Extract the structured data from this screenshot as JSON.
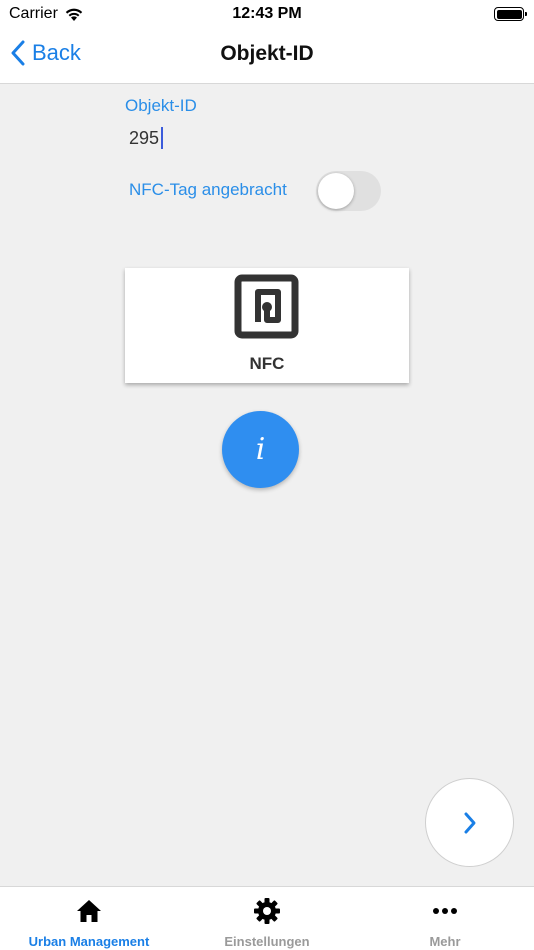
{
  "status_bar": {
    "carrier": "Carrier",
    "time": "12:43 PM",
    "icons": [
      "wifi-icon",
      "battery-icon"
    ]
  },
  "nav": {
    "back_label": "Back",
    "title": "Objekt-ID"
  },
  "form": {
    "objekt_id_label": "Objekt-ID",
    "objekt_id_value": "295",
    "nfc_toggle_label": "NFC-Tag angebracht",
    "nfc_toggle_on": false
  },
  "nfc_button": {
    "label": "NFC",
    "icon": "nfc-icon"
  },
  "info_button": {
    "glyph": "i",
    "icon": "info-icon"
  },
  "next_button": {
    "icon": "chevron-right-icon"
  },
  "tabbar": {
    "tabs": [
      {
        "label": "Urban Management",
        "icon": "home-icon",
        "active": true
      },
      {
        "label": "Einstellungen",
        "icon": "gear-icon",
        "active": false
      },
      {
        "label": "Mehr",
        "icon": "more-icon",
        "active": false
      }
    ]
  },
  "colors": {
    "accent": "#1a7fe6",
    "label_blue": "#2a8ee8",
    "info_button": "#2f8ef0",
    "background": "#f0f0f0"
  }
}
